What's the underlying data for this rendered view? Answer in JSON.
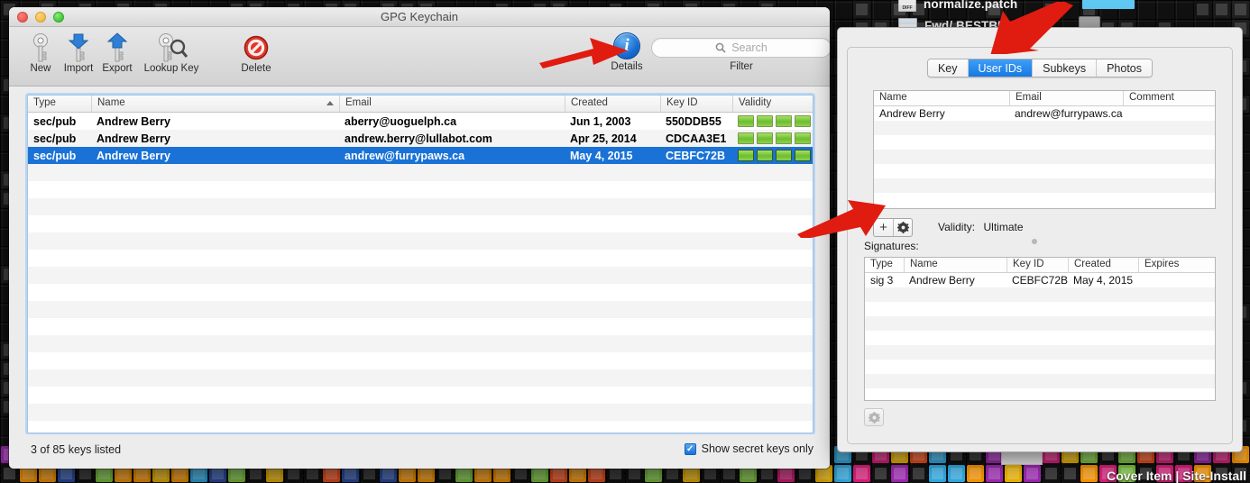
{
  "window": {
    "title": "GPG Keychain",
    "traffic_lights": [
      "close-button",
      "minimize-button",
      "zoom-button"
    ]
  },
  "toolbar": {
    "items": [
      {
        "label": "New",
        "icon": "key-new-icon"
      },
      {
        "label": "Import",
        "icon": "key-import-icon"
      },
      {
        "label": "Export",
        "icon": "key-export-icon"
      },
      {
        "label": "Lookup Key",
        "icon": "key-lookup-icon"
      },
      {
        "label": "Delete",
        "icon": "delete-forbidden-icon"
      }
    ],
    "details_label": "Details",
    "details_glyph": "i",
    "filter_label": "Filter",
    "search_placeholder": "Search",
    "search_value": ""
  },
  "keytable": {
    "columns": [
      "Type",
      "Name",
      "Email",
      "Created",
      "Key ID",
      "Validity"
    ],
    "sort_column": "Name",
    "sort_direction": "ascending",
    "rows": [
      {
        "type": "sec/pub",
        "name": "Andrew Berry",
        "email": "aberry@uoguelph.ca",
        "created": "Jun 1, 2003",
        "key_id": "550DDB55",
        "validity_segments": 4,
        "selected": false
      },
      {
        "type": "sec/pub",
        "name": "Andrew Berry",
        "email": "andrew.berry@lullabot.com",
        "created": "Apr 25, 2014",
        "key_id": "CDCAA3E1",
        "validity_segments": 4,
        "selected": false
      },
      {
        "type": "sec/pub",
        "name": "Andrew Berry",
        "email": "andrew@furrypaws.ca",
        "created": "May 4, 2015",
        "key_id": "CEBFC72B",
        "validity_segments": 4,
        "selected": true
      }
    ]
  },
  "statusbar": {
    "count_text": "3 of 85 keys listed",
    "secret_only_label": "Show secret keys only",
    "secret_only_checked": true,
    "checkmark": "✓"
  },
  "inspector": {
    "tabs": [
      {
        "label": "Key",
        "active": false
      },
      {
        "label": "User IDs",
        "active": true
      },
      {
        "label": "Subkeys",
        "active": false
      },
      {
        "label": "Photos",
        "active": false
      }
    ],
    "userids": {
      "columns": [
        "Name",
        "Email",
        "Comment"
      ],
      "rows": [
        {
          "name": "Andrew Berry",
          "email": "andrew@furrypaws.ca",
          "comment": ""
        }
      ],
      "empty_row_count": 6
    },
    "add_button_label": "+",
    "gear_button_label": "✾",
    "validity_label": "Validity:",
    "validity_value": "Ultimate",
    "signatures_label": "Signatures:",
    "signatures": {
      "columns": [
        "Type",
        "Name",
        "Key ID",
        "Created",
        "Expires"
      ],
      "rows": [
        {
          "type": "sig 3",
          "name": "Andrew Berry",
          "key_id": "CEBFC72B",
          "created": "May 4, 2015",
          "expires": ""
        }
      ],
      "empty_row_count": 8
    },
    "bottom_gear_label": "✾"
  },
  "background": {
    "mail_items": [
      {
        "label": "normalize.patch",
        "icon": "diff-file-icon"
      },
      {
        "label": "Fwd/ BESTBUY",
        "icon": "document-icon"
      }
    ],
    "desktop_caption": "Cover Item | Site-Install"
  },
  "annotations": {
    "arrow_details": "red-arrow-pointing-to-details-button",
    "arrow_useridstab": "red-arrow-pointing-to-user-ids-tab",
    "arrow_adduid": "red-arrow-pointing-to-add-user-id-button",
    "color": "#e01b10"
  },
  "colors": {
    "selection_blue": "#1a72d6",
    "tab_active_blue": "#1479e4",
    "validity_green": "#6dbd2e",
    "annotation_red": "#e01b10",
    "window_chrome": "#ececec"
  }
}
